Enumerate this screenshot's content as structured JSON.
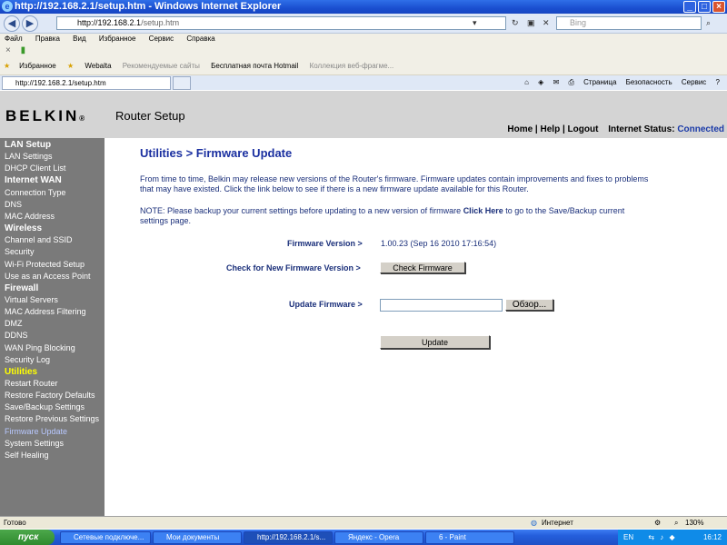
{
  "browser": {
    "title": "http://192.168.2.1/setup.htm - Windows Internet Explorer",
    "address_host": "http://192.168.2.1",
    "address_path": "/setup.htm",
    "search_placeholder": "Bing",
    "menu": [
      "Файл",
      "Правка",
      "Вид",
      "Избранное",
      "Сервис",
      "Справка"
    ],
    "favorites_label": "Избранное",
    "favorites_items": [
      "Webalta",
      "Рекомендуемые сайты",
      "Бесплатная почта Hotmail",
      "Коллекция веб-фрагме..."
    ],
    "tab_title": "http://192.168.2.1/setup.htm",
    "commands": [
      "Страница",
      "Безопасность",
      "Сервис"
    ],
    "status_text": "Готово",
    "zone": "Интернет",
    "zoom": "130%"
  },
  "header": {
    "logo": "BELKIN",
    "app_title": "Router Setup",
    "links": "Home | Help | Logout",
    "internet_status_label": "Internet Status:",
    "internet_status_value": "Connected"
  },
  "sidebar": [
    {
      "label": "LAN Setup",
      "type": "h"
    },
    {
      "label": "LAN Settings",
      "type": "i"
    },
    {
      "label": "DHCP Client List",
      "type": "i"
    },
    {
      "label": "Internet WAN",
      "type": "h"
    },
    {
      "label": "Connection Type",
      "type": "d"
    },
    {
      "label": "DNS",
      "type": "d"
    },
    {
      "label": "MAC Address",
      "type": "d"
    },
    {
      "label": "Wireless",
      "type": "h"
    },
    {
      "label": "Channel and SSID",
      "type": "d"
    },
    {
      "label": "Security",
      "type": "d"
    },
    {
      "label": "Wi-Fi Protected Setup",
      "type": "d"
    },
    {
      "label": "Use as an Access Point",
      "type": "d"
    },
    {
      "label": "Firewall",
      "type": "h"
    },
    {
      "label": "Virtual Servers",
      "type": "d"
    },
    {
      "label": "MAC Address Filtering",
      "type": "d"
    },
    {
      "label": "DMZ",
      "type": "d"
    },
    {
      "label": "DDNS",
      "type": "i"
    },
    {
      "label": "WAN Ping Blocking",
      "type": "i"
    },
    {
      "label": "Security Log",
      "type": "i"
    },
    {
      "label": "Utilities",
      "type": "y"
    },
    {
      "label": "Restart Router",
      "type": "i"
    },
    {
      "label": "Restore Factory Defaults",
      "type": "i"
    },
    {
      "label": "Save/Backup Settings",
      "type": "i"
    },
    {
      "label": "Restore Previous Settings",
      "type": "i"
    },
    {
      "label": "Firmware Update",
      "type": "b"
    },
    {
      "label": "System Settings",
      "type": "i"
    },
    {
      "label": "Self Healing",
      "type": "i"
    }
  ],
  "main": {
    "title": "Utilities > Firmware Update",
    "intro": "From time to time, Belkin may release new versions of the Router's firmware. Firmware updates contain improvements and fixes to problems that may have existed. Click the link below to see if there is a new firmware update available for this Router.",
    "note_before": "NOTE: Please backup your current settings before updating to a new version of firmware ",
    "note_link": "Click Here",
    "note_after": " to go to the Save/Backup current settings page.",
    "firmware_version_label": "Firmware Version >",
    "firmware_version_value": "1.00.23 (Sep 16 2010 17:16:54)",
    "check_label": "Check for New Firmware Version >",
    "check_button": "Check Firmware",
    "update_label": "Update Firmware >",
    "browse_button": "Обзор...",
    "update_button": "Update"
  },
  "taskbar": {
    "start": "пуск",
    "tasks": [
      "Сетевые подключе...",
      "Мои документы",
      "http://192.168.2.1/s...",
      "Яндекс - Opera",
      "6 - Paint"
    ],
    "lang": "EN",
    "clock": "16:12"
  }
}
